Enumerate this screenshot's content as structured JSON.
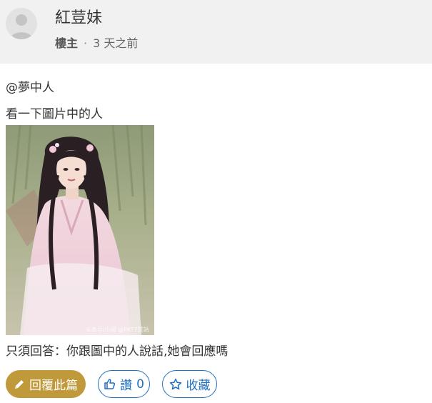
{
  "post": {
    "username": "紅荳妹",
    "role": "樓主",
    "separator": "·",
    "time": "3 天之前",
    "mention": "@夢中人",
    "text_line1": "看一下圖片中的人",
    "text_line2": "只須回答：你跟圖中的人說話,她會回應嗎",
    "image_watermark": "头条号/小闲 @PKT7赞站"
  },
  "actions": {
    "reply_label": "回覆此篇",
    "like_label": "讚",
    "like_count": "0",
    "favorite_label": "收藏"
  },
  "colors": {
    "header_bg": "#f1f1f1",
    "reply_bg": "#c09a3a",
    "accent_blue": "#1f6fbf"
  },
  "icons": {
    "avatar": "user-silhouette-icon",
    "reply": "pencil-icon",
    "like": "thumbs-up-icon",
    "favorite": "star-outline-icon"
  }
}
